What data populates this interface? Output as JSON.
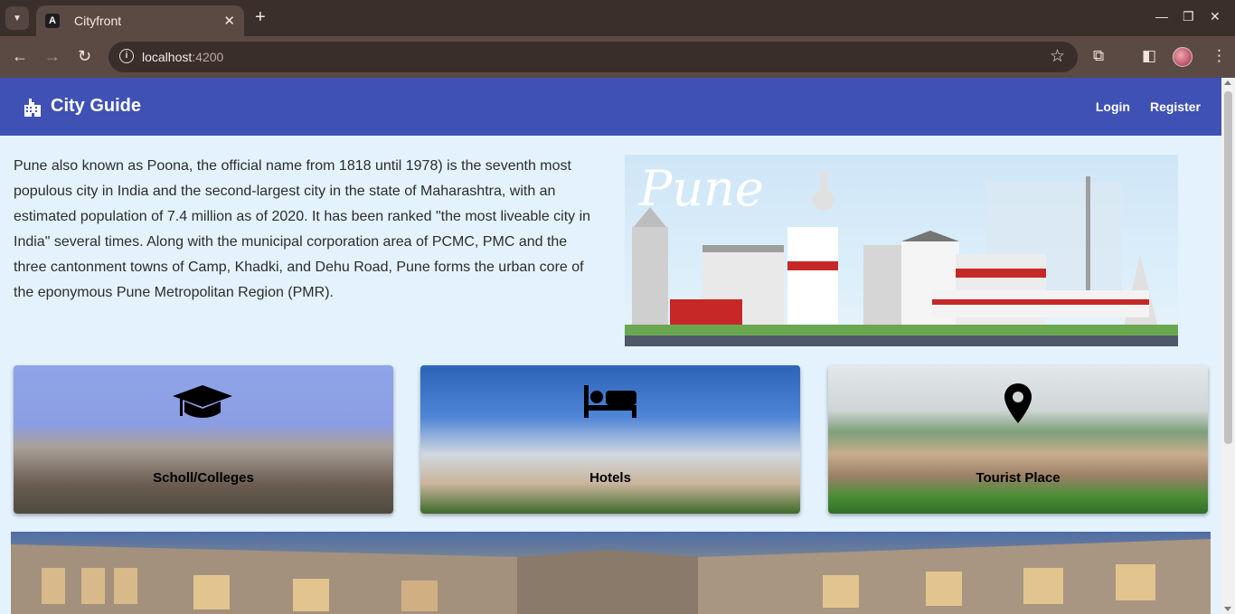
{
  "browser": {
    "tab_title": "Cityfront",
    "tab_favicon_letter": "A",
    "url_host": "localhost",
    "url_port": ":4200"
  },
  "app": {
    "title": "City Guide",
    "nav": {
      "login": "Login",
      "register": "Register"
    },
    "brand_color": "#3f51b5",
    "page_background": "#e3f2fd"
  },
  "intro": {
    "text": "Pune also known as Poona, the official name from 1818 until 1978) is the seventh most populous city in India and the second-largest city in the state of Maharashtra, with an estimated population of 7.4 million as of 2020. It has been ranked \"the most liveable city in India\" several times. Along with the municipal corporation area of PCMC, PMC and the three cantonment towns of Camp, Khadki, and Dehu Road, Pune forms the urban core of the eponymous Pune Metropolitan Region (PMR)."
  },
  "banner": {
    "script_text": "Pune"
  },
  "cards": [
    {
      "label": "Scholl/Colleges",
      "icon": "graduation-cap-icon"
    },
    {
      "label": "Hotels",
      "icon": "bed-icon"
    },
    {
      "label": "Tourist Place",
      "icon": "map-pin-icon"
    }
  ]
}
